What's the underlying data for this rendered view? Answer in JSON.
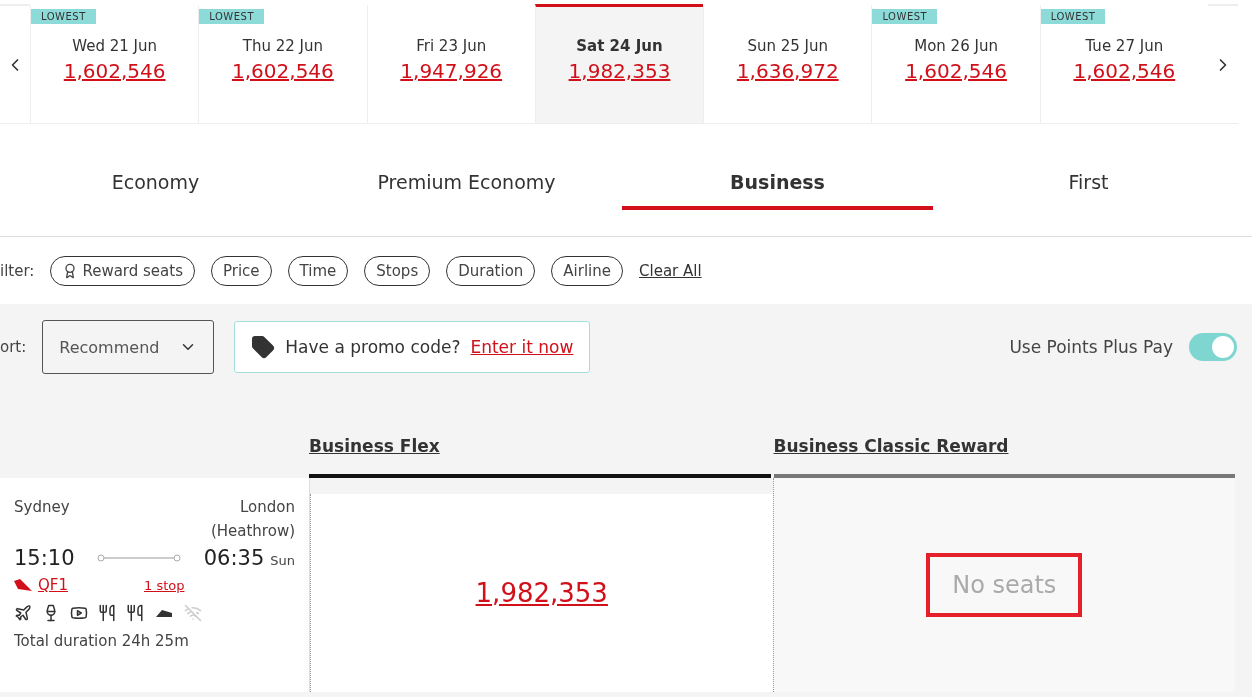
{
  "date_strip": {
    "days": [
      {
        "label": "Wed 21 Jun",
        "price": "1,602,546",
        "badge": "LOWEST",
        "selected": false
      },
      {
        "label": "Thu 22 Jun",
        "price": "1,602,546",
        "badge": "LOWEST",
        "selected": false
      },
      {
        "label": "Fri 23 Jun",
        "price": "1,947,926",
        "selected": false
      },
      {
        "label": "Sat 24 Jun",
        "price": "1,982,353",
        "selected": true
      },
      {
        "label": "Sun 25 Jun",
        "price": "1,636,972",
        "selected": false
      },
      {
        "label": "Mon 26 Jun",
        "price": "1,602,546",
        "badge": "LOWEST",
        "selected": false
      },
      {
        "label": "Tue 27 Jun",
        "price": "1,602,546",
        "badge": "LOWEST",
        "selected": false
      }
    ]
  },
  "cabin_tabs": [
    {
      "label": "Economy",
      "selected": false
    },
    {
      "label": "Premium Economy",
      "selected": false
    },
    {
      "label": "Business",
      "selected": true
    },
    {
      "label": "First",
      "selected": false
    }
  ],
  "filters": {
    "label": "ilter:",
    "chips": [
      {
        "label": "Reward seats",
        "kind": "award"
      },
      {
        "label": "Price",
        "kind": "plain"
      },
      {
        "label": "Time",
        "kind": "plain"
      },
      {
        "label": "Stops",
        "kind": "plain"
      },
      {
        "label": "Duration",
        "kind": "plain"
      },
      {
        "label": "Airline",
        "kind": "plain"
      }
    ],
    "clear": "Clear All"
  },
  "sort": {
    "label": "ort:",
    "value": "Recommend"
  },
  "promo": {
    "text": "Have a promo code?",
    "link": "Enter it now"
  },
  "points_plus_pay": {
    "label": "Use Points Plus Pay",
    "on": true
  },
  "fare_columns": [
    {
      "title": "Business Flex",
      "selected": true
    },
    {
      "title": "Business Classic Reward",
      "selected": false
    }
  ],
  "flight": {
    "origin": "Sydney",
    "destination": "London",
    "destination_detail": "(Heathrow)",
    "depart": "15:10",
    "arrive": "06:35",
    "arrive_day": "Sun",
    "flight_number": "QF1",
    "stops": "1 stop",
    "amenities": [
      {
        "kind": "a380",
        "available": true
      },
      {
        "kind": "drink",
        "available": true
      },
      {
        "kind": "video",
        "available": true
      },
      {
        "kind": "meal",
        "available": true
      },
      {
        "kind": "dining",
        "available": true
      },
      {
        "kind": "bed",
        "available": true
      },
      {
        "kind": "wifi",
        "available": false
      }
    ],
    "duration": "Total duration 24h 25m",
    "fares": [
      {
        "kind": "price",
        "text": "1,982,353",
        "highlighted": false
      },
      {
        "kind": "unavailable",
        "text": "No seats",
        "highlighted": true
      }
    ]
  }
}
